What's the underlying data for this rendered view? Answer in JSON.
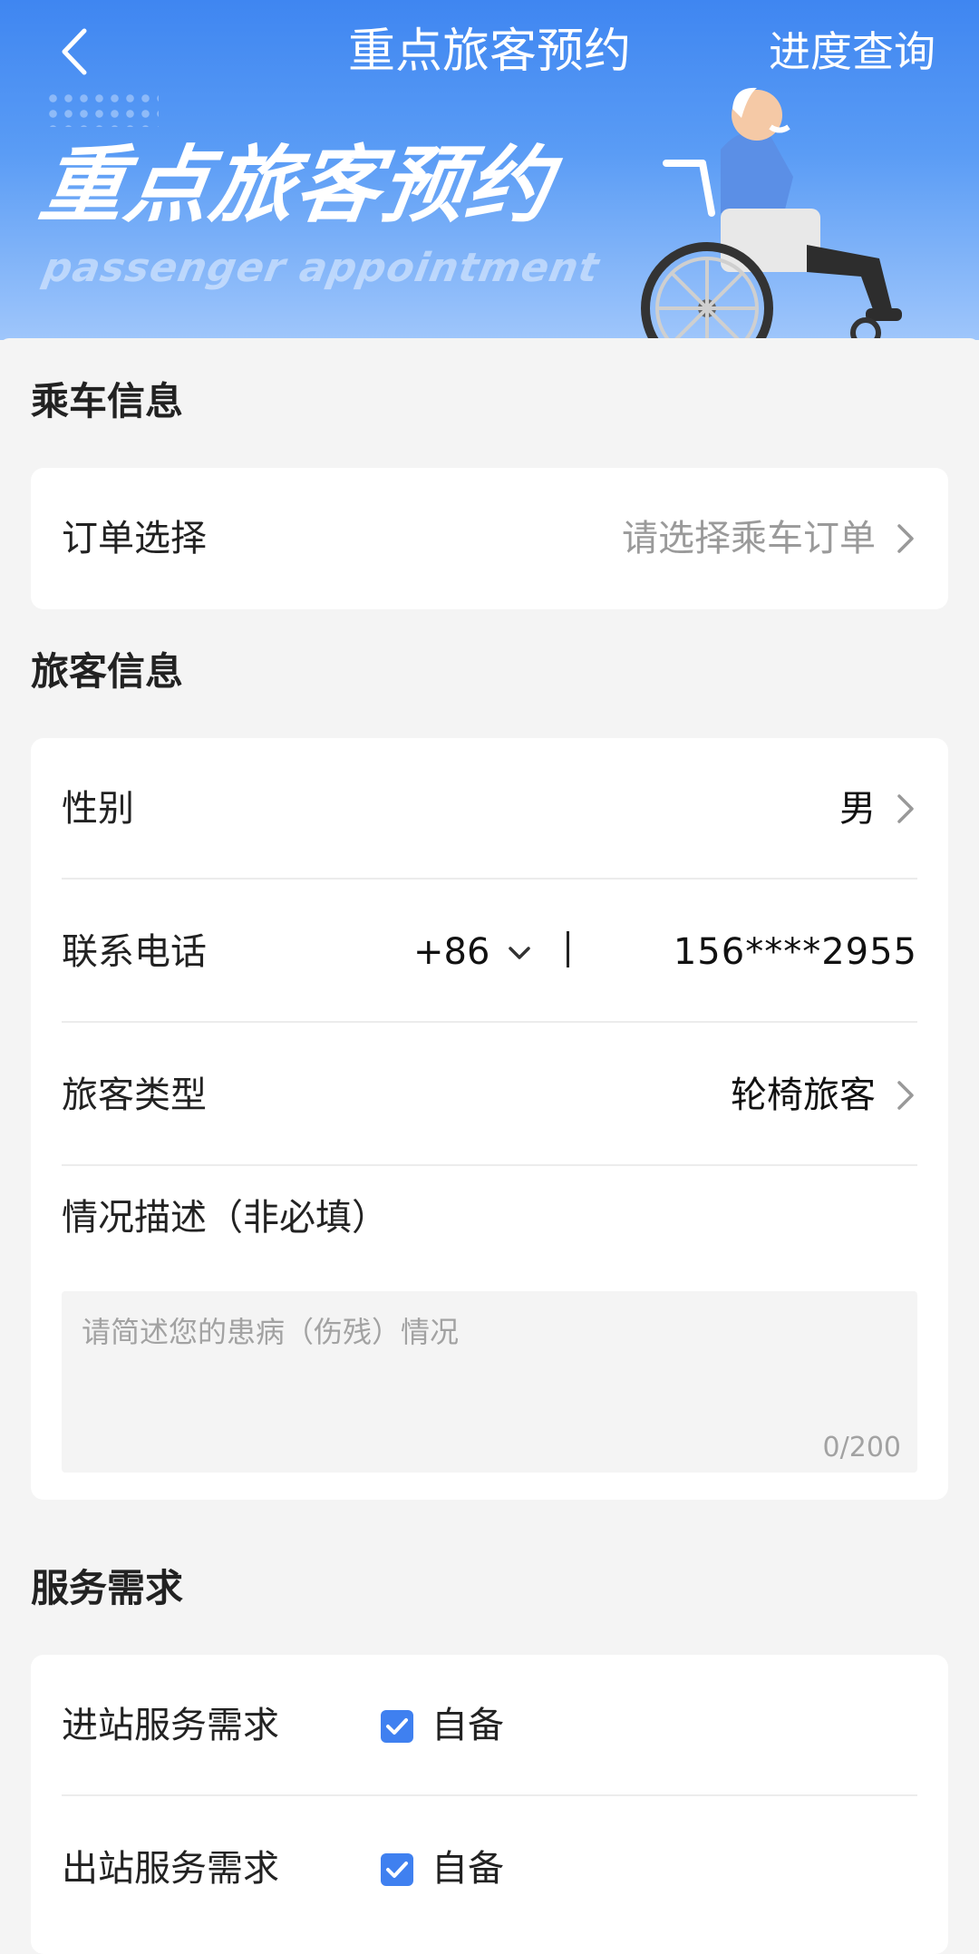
{
  "nav": {
    "title": "重点旅客预约",
    "right_action": "进度查询",
    "back_icon": "chevron-left-icon"
  },
  "banner": {
    "title": "重点旅客预约",
    "subtitle": "passenger appointment",
    "illustration": "wheelchair-passenger-illustration"
  },
  "sections": {
    "ride_info": {
      "title": "乘车信息",
      "order_label": "订单选择",
      "order_placeholder": "请选择乘车订单"
    },
    "passenger_info": {
      "title": "旅客信息",
      "gender_label": "性别",
      "gender_value": "男",
      "phone_label": "联系电话",
      "phone_code": "+86",
      "phone_number": "156****2955",
      "type_label": "旅客类型",
      "type_value": "轮椅旅客",
      "desc_label": "情况描述（非必填）",
      "desc_placeholder": "请简述您的患病（伤残）情况",
      "desc_count": "0/200"
    },
    "service": {
      "title": "服务需求",
      "inbound_label": "进站服务需求",
      "inbound_option": "自备",
      "inbound_checked": true,
      "outbound_label": "出站服务需求",
      "outbound_option": "自备",
      "outbound_checked": true
    }
  },
  "colors": {
    "banner_blue": "#3f86f1",
    "checkbox_blue": "#3f80f0",
    "placeholder_gray": "#9a9a9a"
  }
}
